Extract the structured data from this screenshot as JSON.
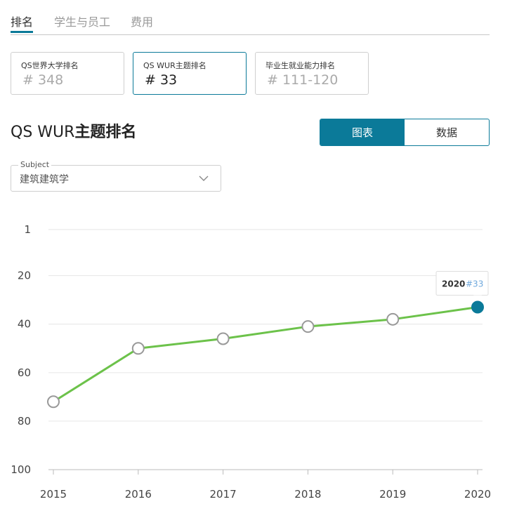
{
  "tabs": [
    {
      "label": "排名",
      "active": true
    },
    {
      "label": "学生与员工",
      "active": false
    },
    {
      "label": "费用",
      "active": false
    }
  ],
  "rank_cards": [
    {
      "label": "QS世界大学排名",
      "value": "# 348",
      "active": false
    },
    {
      "label": "QS WUR主题排名",
      "value": "# 33",
      "active": true
    },
    {
      "label": "毕业生就业能力排名",
      "value": "# 111-120",
      "active": false
    }
  ],
  "section": {
    "title_prefix": "QS WUR",
    "title_bold": "主题排名"
  },
  "view_toggle": {
    "chart_label": "图表",
    "data_label": "数据",
    "selected": "chart"
  },
  "subject_select": {
    "legend": "Subject",
    "value": "建筑建筑学"
  },
  "colors": {
    "accent": "#0b7a99",
    "line": "#6cc24a",
    "tooltip_rank": "#6fa8dc"
  },
  "chart_data": {
    "type": "line",
    "x": [
      2015,
      2016,
      2017,
      2018,
      2019,
      2020
    ],
    "series": [
      {
        "values": [
          72,
          50,
          46,
          41,
          38,
          33
        ]
      }
    ],
    "y_ticks": [
      1,
      20,
      40,
      60,
      80,
      100
    ],
    "ylim": [
      1,
      100
    ],
    "y_inverted": true,
    "grid": true,
    "highlight": {
      "year": "2020",
      "rank": "#33"
    }
  }
}
